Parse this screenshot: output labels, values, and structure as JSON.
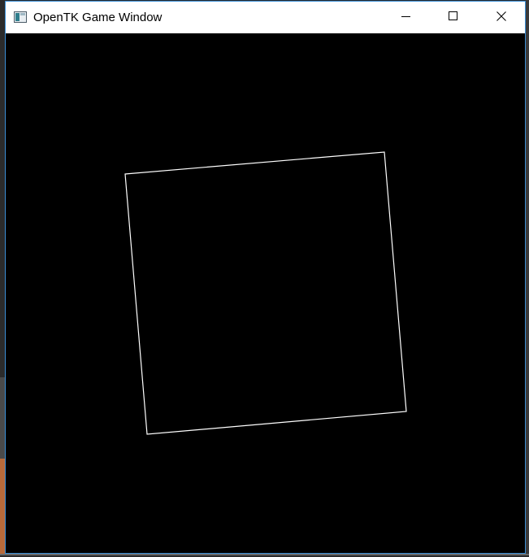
{
  "window": {
    "title": "OpenTK Game Window",
    "accent_color": "#3c8fd6",
    "background_color": "#000000"
  },
  "titlebar": {
    "icons": {
      "app": "opentk-window-icon",
      "minimize": "minimize-icon",
      "maximize": "maximize-icon",
      "close": "close-icon"
    }
  },
  "scene": {
    "shape": "rotated-square-outline",
    "line_color": "#ffffff"
  }
}
